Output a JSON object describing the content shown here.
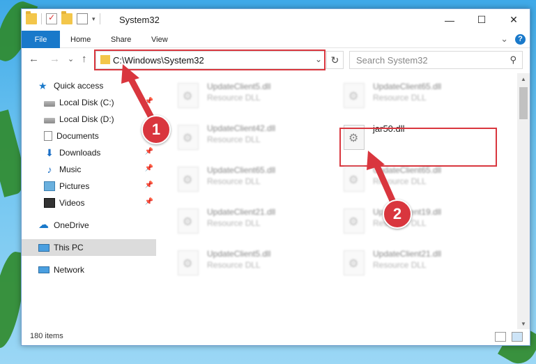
{
  "window": {
    "title": "System32",
    "minimize": "—",
    "maximize": "☐",
    "close": "✕"
  },
  "ribbon": {
    "tabs": [
      "File",
      "Home",
      "Share",
      "View"
    ],
    "expand": "⌄",
    "help": "?"
  },
  "nav": {
    "back": "←",
    "forward": "→",
    "recent": "⌄",
    "up": "↑",
    "address": "C:\\Windows\\System32",
    "address_dropdown": "⌄",
    "refresh": "↻",
    "search_placeholder": "Search System32",
    "search_icon": "⚲"
  },
  "sidebar": {
    "items": [
      {
        "label": "Quick access",
        "icon": "star-icon",
        "pinned": false
      },
      {
        "label": "Local Disk (C:)",
        "icon": "disk-icon",
        "pinned": true
      },
      {
        "label": "Local Disk (D:)",
        "icon": "disk-icon",
        "pinned": false
      },
      {
        "label": "Documents",
        "icon": "documents-icon",
        "pinned": false
      },
      {
        "label": "Downloads",
        "icon": "download-icon",
        "pinned": true
      },
      {
        "label": "Music",
        "icon": "music-icon",
        "pinned": true
      },
      {
        "label": "Pictures",
        "icon": "pictures-icon",
        "pinned": true
      },
      {
        "label": "Videos",
        "icon": "videos-icon",
        "pinned": true
      },
      {
        "label": "OneDrive",
        "icon": "cloud-icon",
        "pinned": false
      },
      {
        "label": "This PC",
        "icon": "computer-icon",
        "pinned": false,
        "selected": true
      },
      {
        "label": "Network",
        "icon": "network-icon",
        "pinned": false
      }
    ],
    "pin_glyph": "📌"
  },
  "files": [
    {
      "name": "UpdateClient5.dll",
      "type": "Resource DLL"
    },
    {
      "name": "UpdateClient65.dll",
      "type": "Resource DLL"
    },
    {
      "name": "UpdateClient42.dll",
      "type": "Resource DLL"
    },
    {
      "name": "jar50.dll",
      "type": ""
    },
    {
      "name": "UpdateClient65.dll",
      "type": "Resource DLL"
    },
    {
      "name": "UpdateClient65.dll",
      "type": "Resource DLL"
    },
    {
      "name": "UpdateClient21.dll",
      "type": "Resource DLL"
    },
    {
      "name": "UpdateClient19.dll",
      "type": "Resource DLL"
    },
    {
      "name": "UpdateClient5.dll",
      "type": "Resource DLL"
    },
    {
      "name": "UpdateClient21.dll",
      "type": "Resource DLL"
    }
  ],
  "status": {
    "item_count": "180 items"
  },
  "callouts": [
    "1",
    "2"
  ],
  "colors": {
    "accent": "#1979ca",
    "highlight": "#d9363e"
  }
}
